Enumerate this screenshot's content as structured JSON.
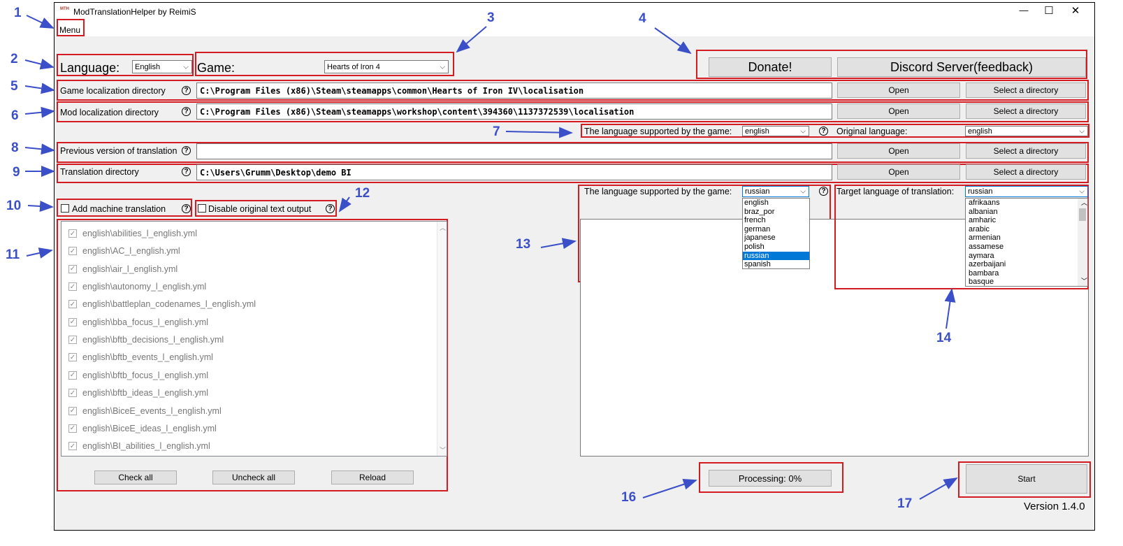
{
  "window": {
    "title": "ModTranslationHelper by ReimiS",
    "app_icon_text": "MTH",
    "controls": [
      "—",
      "☐",
      "✕"
    ]
  },
  "menu": {
    "label": "Menu"
  },
  "language_selector": {
    "label": "Language:",
    "value": "English"
  },
  "game_selector": {
    "label": "Game:",
    "value": "Hearts of Iron 4"
  },
  "top_buttons": {
    "donate": "Donate!",
    "discord": "Discord Server(feedback)"
  },
  "paths": {
    "game_loc": {
      "label": "Game localization directory",
      "value": "C:\\Program Files (x86)\\Steam\\steamapps\\common\\Hearts of Iron IV\\localisation",
      "open": "Open",
      "select": "Select a directory"
    },
    "mod_loc": {
      "label": "Mod localization directory",
      "value": "C:\\Program Files (x86)\\Steam\\steamapps\\workshop\\content\\394360\\1137372539\\localisation",
      "open": "Open",
      "select": "Select a directory"
    },
    "prev_version": {
      "label": "Previous version of translation",
      "value": "",
      "open": "Open",
      "select": "Select a directory"
    },
    "translation_dir": {
      "label": "Translation directory",
      "value": "C:\\Users\\Grumm\\Desktop\\demo BI",
      "open": "Open",
      "select": "Select a directory"
    }
  },
  "source_lang": {
    "label": "The language supported by the game:",
    "value": "english",
    "original_label": "Original language:",
    "original_value": "english"
  },
  "target_lang": {
    "label": "The language supported by the game:",
    "value": "russian",
    "options": [
      "english",
      "braz_por",
      "french",
      "german",
      "japanese",
      "polish",
      "russian",
      "spanish"
    ],
    "selected": "russian",
    "target_label": "Target language of translation:",
    "target_value": "russian",
    "target_options": [
      "afrikaans",
      "albanian",
      "amharic",
      "arabic",
      "armenian",
      "assamese",
      "aymara",
      "azerbaijani",
      "bambara",
      "basque"
    ]
  },
  "options": {
    "machine_translation": "Add machine translation",
    "disable_original": "Disable original text output"
  },
  "files": [
    "english\\abilities_l_english.yml",
    "english\\AC_l_english.yml",
    "english\\air_l_english.yml",
    "english\\autonomy_l_english.yml",
    "english\\battleplan_codenames_l_english.yml",
    "english\\bba_focus_l_english.yml",
    "english\\bftb_decisions_l_english.yml",
    "english\\bftb_events_l_english.yml",
    "english\\bftb_focus_l_english.yml",
    "english\\bftb_ideas_l_english.yml",
    "english\\BiceE_events_l_english.yml",
    "english\\BiceE_ideas_l_english.yml",
    "english\\BI_abilities_l_english.yml"
  ],
  "list_buttons": {
    "check_all": "Check all",
    "uncheck_all": "Uncheck all",
    "reload": "Reload"
  },
  "progress": {
    "label": "Processing: 0%",
    "value": 0
  },
  "start_button": "Start",
  "version": "Version 1.4.0",
  "help_glyph": "?",
  "annotations": [
    "1",
    "2",
    "3",
    "4",
    "5",
    "6",
    "7",
    "8",
    "9",
    "10",
    "11",
    "12",
    "13",
    "14",
    "16",
    "17"
  ],
  "colors": {
    "annotation": "#3a4fc8",
    "highlight_box": "#d41b22",
    "selection": "#0078d7",
    "window_bg": "#f0f0f0"
  }
}
